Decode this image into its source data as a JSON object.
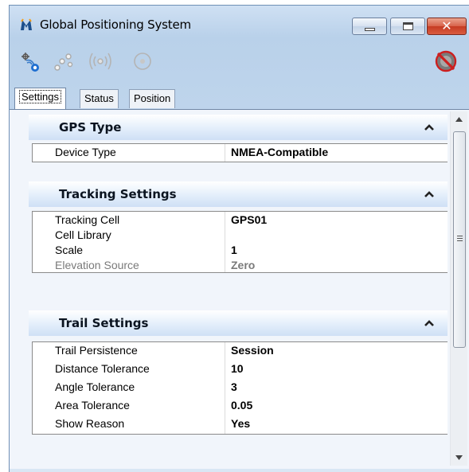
{
  "window": {
    "title": "Global Positioning System",
    "caption": {
      "close_glyph": "✕"
    }
  },
  "toolbar": {
    "icons": [
      "gps-connect-icon",
      "satellites-icon",
      "signal-broadcast-icon",
      "target-icon",
      "disconnect-icon"
    ]
  },
  "tabs": [
    {
      "label": "Settings",
      "active": true
    },
    {
      "label": "Status",
      "active": false
    },
    {
      "label": "Position",
      "active": false
    }
  ],
  "sections": {
    "gps_type": {
      "title": "GPS Type",
      "rows": [
        {
          "name": "Device Type",
          "value": "NMEA-Compatible"
        }
      ]
    },
    "tracking": {
      "title": "Tracking Settings",
      "rows": [
        {
          "name": "Tracking Cell",
          "value": "GPS01"
        },
        {
          "name": "Cell Library",
          "value": ""
        },
        {
          "name": "Scale",
          "value": "1"
        },
        {
          "name": "Elevation Source",
          "value": "Zero",
          "disabled": true
        }
      ]
    },
    "trail": {
      "title": "Trail Settings",
      "rows": [
        {
          "name": "Trail Persistence",
          "value": "Session"
        },
        {
          "name": "Distance Tolerance",
          "value": "10"
        },
        {
          "name": "Angle Tolerance",
          "value": "3"
        },
        {
          "name": "Area Tolerance",
          "value": "0.05"
        },
        {
          "name": "Show Reason",
          "value": "Yes"
        }
      ]
    }
  },
  "colors": {
    "accent": "#1a73d9",
    "header_gradient_end": "#cfe0f5",
    "disabled_text": "#7a7a7a"
  }
}
